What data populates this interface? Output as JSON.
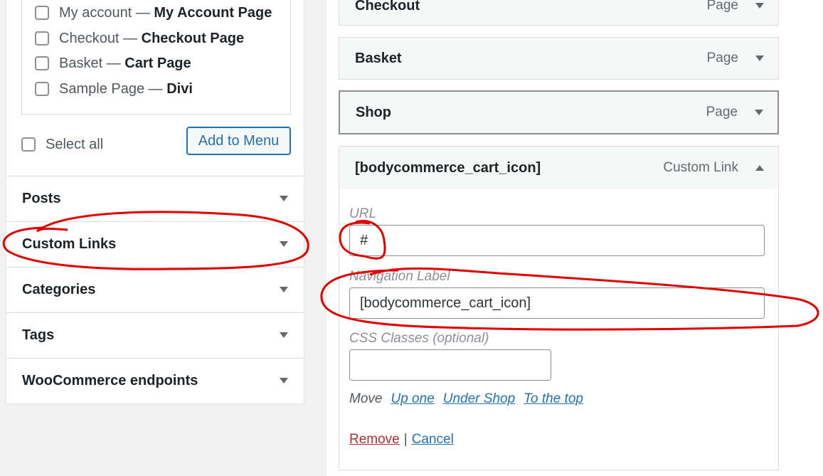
{
  "left": {
    "pages": [
      {
        "title": "My account",
        "sep": " — ",
        "template": "My Account Page"
      },
      {
        "title": "Checkout",
        "sep": " — ",
        "template": "Checkout Page"
      },
      {
        "title": "Basket",
        "sep": " — ",
        "template": "Cart Page"
      },
      {
        "title": "Sample Page",
        "sep": " — ",
        "template": "Divi"
      }
    ],
    "select_all": "Select all",
    "add_to_menu": "Add to Menu",
    "accordions": [
      "Posts",
      "Custom Links",
      "Categories",
      "Tags",
      "WooCommerce endpoints"
    ]
  },
  "menu_items": [
    {
      "title": "Checkout",
      "type": "Page"
    },
    {
      "title": "Basket",
      "type": "Page"
    },
    {
      "title": "Shop",
      "type": "Page"
    },
    {
      "title": "[bodycommerce_cart_icon]",
      "type": "Custom Link"
    }
  ],
  "settings": {
    "url_label": "URL",
    "url_value": "#",
    "nav_label_label": "Navigation Label",
    "nav_label_value": "[bodycommerce_cart_icon]",
    "css_label": "CSS Classes (optional)",
    "css_value": "",
    "move_label": "Move",
    "move_links": [
      "Up one",
      "Under Shop",
      "To the top"
    ],
    "remove": "Remove",
    "divider": "|",
    "cancel": "Cancel"
  },
  "colors": {
    "annotation": "#e00000",
    "link": "#2271b1",
    "remove": "#b32d2e"
  }
}
